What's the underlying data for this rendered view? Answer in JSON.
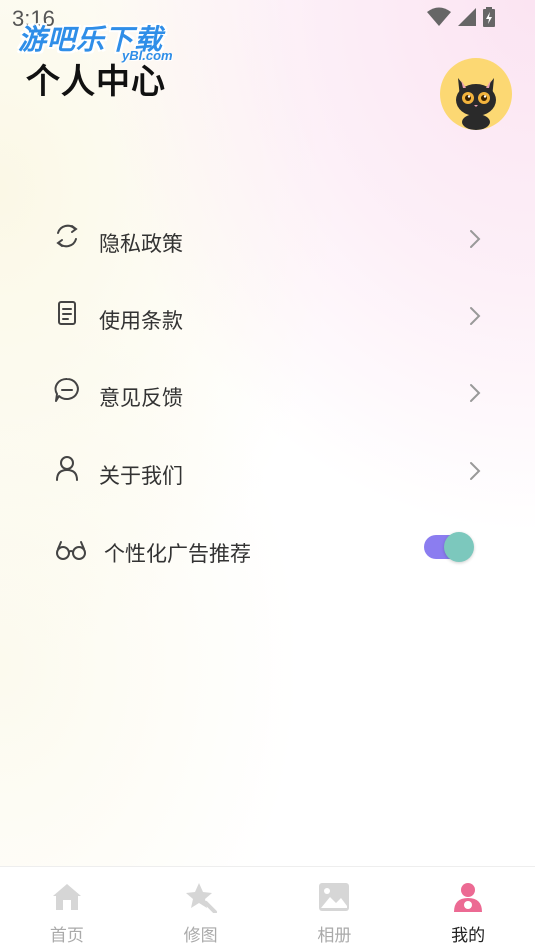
{
  "status_bar": {
    "time": "3:16"
  },
  "watermark": {
    "title": "游吧乐下载",
    "subtitle": "yBl.com"
  },
  "header": {
    "title": "个人中心"
  },
  "menu": [
    {
      "label": "隐私政策",
      "icon": "refresh-circle-icon"
    },
    {
      "label": "使用条款",
      "icon": "document-icon"
    },
    {
      "label": "意见反馈",
      "icon": "chat-bubble-icon"
    },
    {
      "label": "关于我们",
      "icon": "person-icon"
    }
  ],
  "ad_toggle": {
    "label": "个性化广告推荐",
    "icon": "glasses-icon",
    "on": true
  },
  "bottom_nav": [
    {
      "label": "首页",
      "icon": "home-icon",
      "active": false
    },
    {
      "label": "修图",
      "icon": "star-edit-icon",
      "active": false
    },
    {
      "label": "相册",
      "icon": "image-icon",
      "active": false
    },
    {
      "label": "我的",
      "icon": "user-icon",
      "active": true
    }
  ],
  "colors": {
    "accent": "#8b7df0",
    "toggle_knob": "#7cc8bd",
    "active_nav": "#ec6a93",
    "inactive_nav": "#d6d6d6",
    "watermark": "#2f8ee8"
  }
}
